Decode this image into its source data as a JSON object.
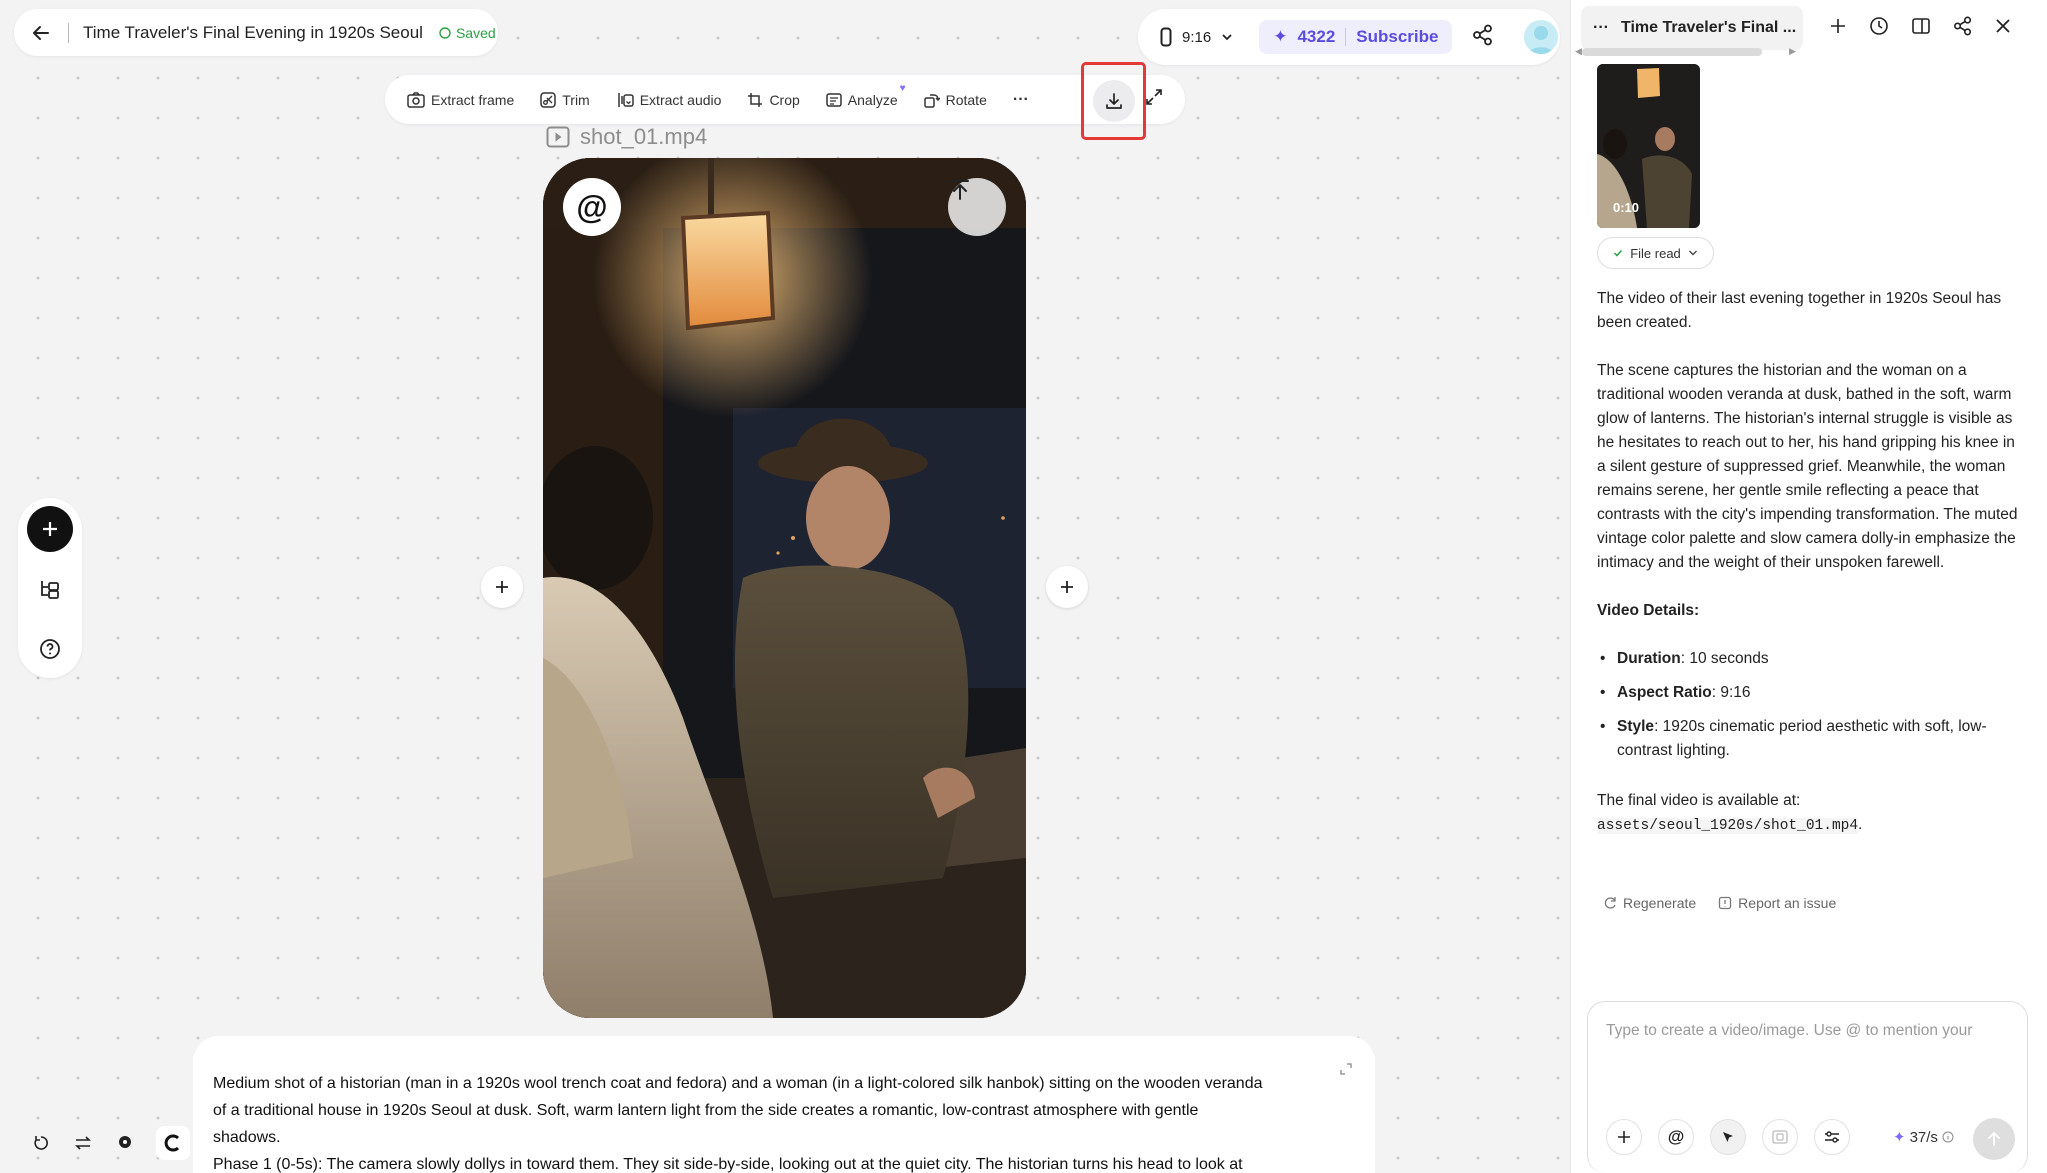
{
  "header": {
    "title": "Time Traveler's Final Evening in 1920s Seoul",
    "saved_label": "Saved"
  },
  "top_right": {
    "aspect_ratio": "9:16",
    "credits": "4322",
    "subscribe_label": "Subscribe"
  },
  "toolbar": {
    "extract_frame": "Extract frame",
    "trim": "Trim",
    "extract_audio": "Extract audio",
    "crop": "Crop",
    "analyze": "Analyze",
    "rotate": "Rotate",
    "more": "···"
  },
  "canvas": {
    "file_name": "shot_01.mp4",
    "at_symbol": "@"
  },
  "prompt": {
    "line1": "Medium shot of a historian (man in a 1920s wool trench coat and fedora) and a woman (in a light-colored silk hanbok) sitting on the wooden veranda",
    "line2": "of a traditional house in 1920s Seoul at dusk. Soft, warm lantern light from the side creates a romantic, low-contrast atmosphere with gentle",
    "line3": "shadows.",
    "line4": "Phase 1 (0-5s): The camera slowly dollys in toward them. They sit side-by-side, looking out at the quiet city. The historian turns his head to look at"
  },
  "sidebar": {
    "tab_title": "Time Traveler's Final ...",
    "thumb_time": "0:10",
    "file_read_label": "File read",
    "para1": "The video of their last evening together in 1920s Seoul has been created.",
    "para2": "The scene captures the historian and the woman on a traditional wooden veranda at dusk, bathed in the soft, warm glow of lanterns. The historian's internal struggle is visible as he hesitates to reach out to her, his hand gripping his knee in a silent gesture of suppressed grief. Meanwhile, the woman remains serene, her gentle smile reflecting a peace that contrasts with the city's impending transformation. The muted vintage color palette and slow camera dolly-in emphasize the intimacy and the weight of their unspoken farewell.",
    "details_heading": "Video Details:",
    "details": [
      {
        "key": "Duration",
        "value": ": 10 seconds"
      },
      {
        "key": "Aspect Ratio",
        "value": ": 9:16"
      },
      {
        "key": "Style",
        "value": ": 1920s cinematic period aesthetic with soft, low-contrast lighting."
      }
    ],
    "final_prefix": "The final video is available at: ",
    "final_path": "assets/seoul_1920s/shot_01.mp4",
    "final_suffix": ".",
    "regenerate": "Regenerate",
    "report": "Report an issue",
    "chat_placeholder": "Type to create a video/image. Use @ to mention your",
    "chat_at": "@",
    "speed": "37/s"
  }
}
